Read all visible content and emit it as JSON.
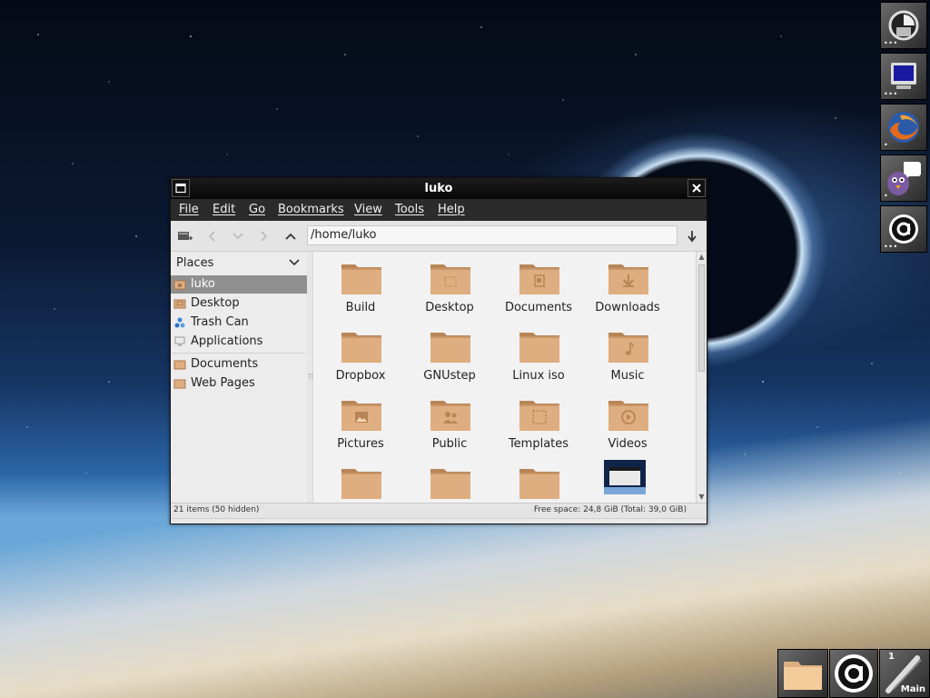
{
  "window": {
    "title": "luko",
    "menu": [
      "File",
      "Edit",
      "Go",
      "Bookmarks",
      "View",
      "Tools",
      "Help"
    ],
    "location": "/home/luko",
    "sidebar": {
      "header": "Places",
      "places": [
        {
          "label": "luko",
          "icon": "home-folder-icon",
          "selected": true
        },
        {
          "label": "Desktop",
          "icon": "desktop-folder-icon",
          "selected": false
        },
        {
          "label": "Trash Can",
          "icon": "recycle-icon",
          "selected": false
        },
        {
          "label": "Applications",
          "icon": "computer-icon",
          "selected": false
        }
      ],
      "bookmarks": [
        {
          "label": "Documents",
          "icon": "folder-icon"
        },
        {
          "label": "Web Pages",
          "icon": "folder-icon"
        }
      ]
    },
    "files": [
      {
        "label": "Build",
        "icon": "folder-icon"
      },
      {
        "label": "Desktop",
        "icon": "desktop-folder-icon"
      },
      {
        "label": "Documents",
        "icon": "documents-folder-icon"
      },
      {
        "label": "Downloads",
        "icon": "downloads-folder-icon"
      },
      {
        "label": "Dropbox",
        "icon": "folder-icon"
      },
      {
        "label": "GNUstep",
        "icon": "folder-icon"
      },
      {
        "label": "Linux iso",
        "icon": "folder-icon"
      },
      {
        "label": "Music",
        "icon": "music-folder-icon"
      },
      {
        "label": "Pictures",
        "icon": "pictures-folder-icon"
      },
      {
        "label": "Public",
        "icon": "public-folder-icon"
      },
      {
        "label": "Templates",
        "icon": "templates-folder-icon"
      },
      {
        "label": "Videos",
        "icon": "videos-folder-icon"
      },
      {
        "label": "",
        "icon": "folder-icon"
      },
      {
        "label": "",
        "icon": "folder-icon"
      },
      {
        "label": "",
        "icon": "folder-icon"
      },
      {
        "label": "",
        "icon": "image-thumbnail-icon"
      }
    ],
    "status": {
      "left": "21 items (50 hidden)",
      "right": "Free space: 24,8 GiB (Total: 39,0 GiB)"
    }
  },
  "dock": {
    "right": [
      {
        "name": "clock-dock-icon"
      },
      {
        "name": "monitor-dock-icon"
      },
      {
        "name": "firefox-dock-icon"
      },
      {
        "name": "pidgin-dock-icon"
      },
      {
        "name": "a-app-dock-icon"
      }
    ],
    "bottom": [
      {
        "name": "folder-dock-icon"
      },
      {
        "name": "a-app-dock-icon"
      },
      {
        "name": "workspace-clip-icon",
        "workspace_number": "1",
        "workspace_name": "Main"
      }
    ]
  },
  "colors": {
    "folder": "#deae80",
    "folder_dark": "#b88556",
    "selection": "#8f8f8f",
    "titlebar": "#0a0a0a",
    "menubar": "#2b2b2b"
  }
}
